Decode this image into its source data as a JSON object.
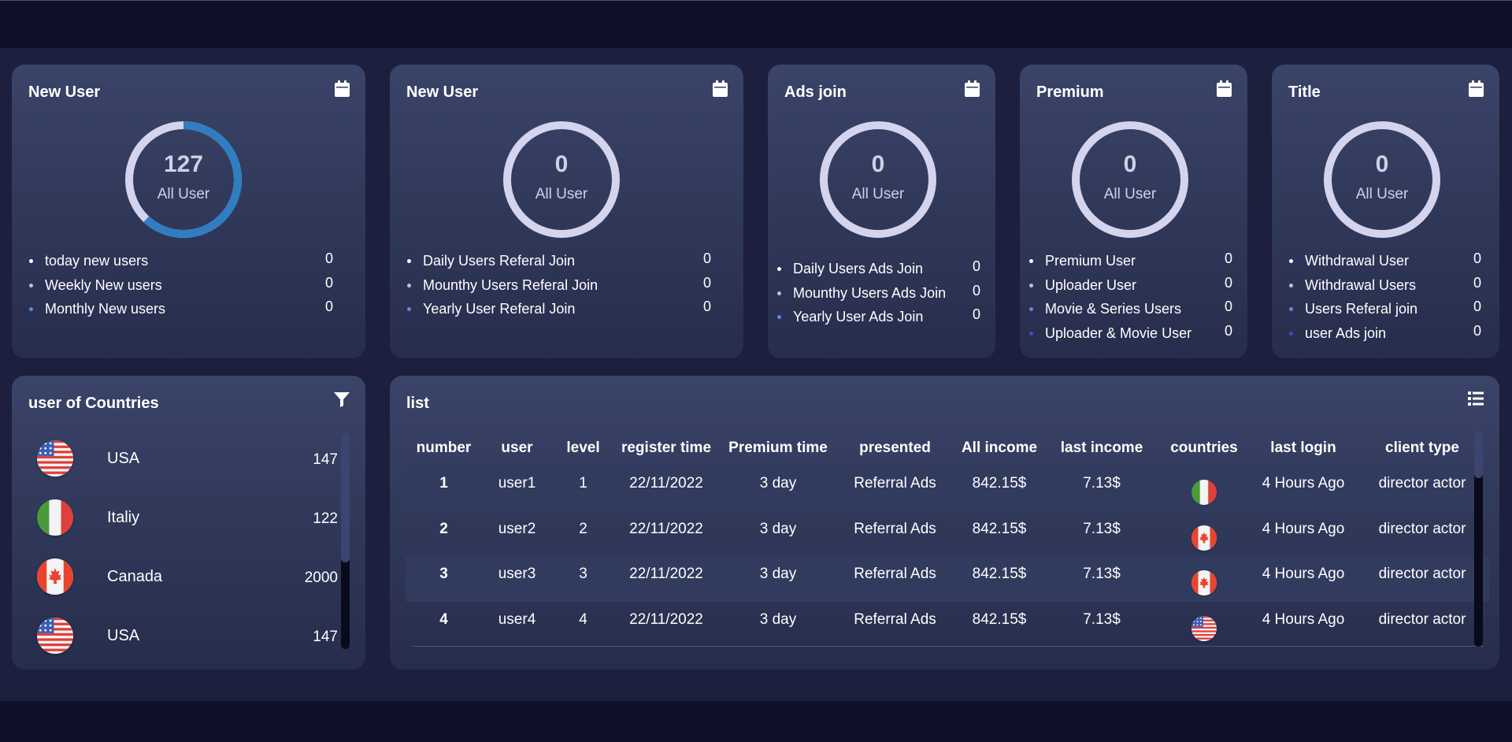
{
  "colors": {
    "ring_track": "#d4d4ef",
    "ring_progress": "#2f7ec2",
    "bullet_1": "#ffffff",
    "bullet_2": "#a9c4f5",
    "bullet_3": "#5b8bdc",
    "bullet_4": "#4848c8"
  },
  "stat_cards": [
    {
      "title": "New User",
      "icon": "calendar-icon",
      "ring_value": "127",
      "ring_label": "All User",
      "progress": 0.62,
      "items": [
        {
          "label": "today new users",
          "value": "0"
        },
        {
          "label": "Weekly New users",
          "value": "0"
        },
        {
          "label": "Monthly New users",
          "value": "0"
        }
      ]
    },
    {
      "title": "New User",
      "icon": "calendar-icon",
      "ring_value": "0",
      "ring_label": "All User",
      "progress": 0,
      "items": [
        {
          "label": "Daily Users Referal Join",
          "value": "0"
        },
        {
          "label": "Mounthy Users Referal Join",
          "value": "0"
        },
        {
          "label": "Yearly User Referal Join",
          "value": "0"
        }
      ]
    },
    {
      "title": "Ads join",
      "icon": "calendar-icon",
      "ring_value": "0",
      "ring_label": "All User",
      "progress": 0,
      "items": [
        {
          "label": "Daily Users Ads Join",
          "value": "0"
        },
        {
          "label": "Mounthy Users Ads Join",
          "value": "0"
        },
        {
          "label": "Yearly User Ads Join",
          "value": "0"
        }
      ]
    },
    {
      "title": "Premium",
      "icon": "calendar-icon",
      "ring_value": "0",
      "ring_label": "All User",
      "progress": 0,
      "items": [
        {
          "label": "Premium User",
          "value": "0"
        },
        {
          "label": "Uploader User",
          "value": "0"
        },
        {
          "label": "Movie & Series Users",
          "value": "0"
        },
        {
          "label": "Uploader & Movie User",
          "value": "0"
        }
      ]
    },
    {
      "title": "Title",
      "icon": "calendar-icon",
      "ring_value": "0",
      "ring_label": "All User",
      "progress": 0,
      "items": [
        {
          "label": "Withdrawal User",
          "value": "0"
        },
        {
          "label": "Withdrawal Users",
          "value": "0"
        },
        {
          "label": "Users Referal join",
          "value": "0"
        },
        {
          "label": "user Ads join",
          "value": "0"
        }
      ]
    }
  ],
  "countries_card": {
    "title": "user of Countries",
    "icon": "filter-icon",
    "rows": [
      {
        "flag": "usa-flag-icon",
        "name": "USA",
        "count": "147"
      },
      {
        "flag": "italy-flag-icon",
        "name": "Italiy",
        "count": "122"
      },
      {
        "flag": "canada-flag-icon",
        "name": "Canada",
        "count": "2000"
      },
      {
        "flag": "usa-flag-icon",
        "name": "USA",
        "count": "147"
      }
    ]
  },
  "list_card": {
    "title": "list",
    "icon": "list-icon",
    "columns": [
      "number",
      "user",
      "level",
      "register time",
      "Premium time",
      "presented",
      "All income",
      "last income",
      "countries",
      "last login",
      "client type"
    ],
    "rows": [
      {
        "number": "1",
        "user": "user1",
        "level": "1",
        "register": "22/11/2022",
        "premium": "3 day",
        "presented": "Referral Ads",
        "all_income": "842.15$",
        "last_income": "7.13$",
        "country": "italy-flag-icon",
        "last_login": "4 Hours Ago",
        "client": "director actor"
      },
      {
        "number": "2",
        "user": "user2",
        "level": "2",
        "register": "22/11/2022",
        "premium": "3 day",
        "presented": "Referral Ads",
        "all_income": "842.15$",
        "last_income": "7.13$",
        "country": "canada-flag-icon",
        "last_login": "4 Hours Ago",
        "client": "director actor"
      },
      {
        "number": "3",
        "user": "user3",
        "level": "3",
        "register": "22/11/2022",
        "premium": "3 day",
        "presented": "Referral Ads",
        "all_income": "842.15$",
        "last_income": "7.13$",
        "country": "canada-flag-icon",
        "last_login": "4 Hours Ago",
        "client": "director actor"
      },
      {
        "number": "4",
        "user": "user4",
        "level": "4",
        "register": "22/11/2022",
        "premium": "3 day",
        "presented": "Referral Ads",
        "all_income": "842.15$",
        "last_income": "7.13$",
        "country": "usa-flag-icon",
        "last_login": "4 Hours Ago",
        "client": "director actor"
      }
    ]
  }
}
